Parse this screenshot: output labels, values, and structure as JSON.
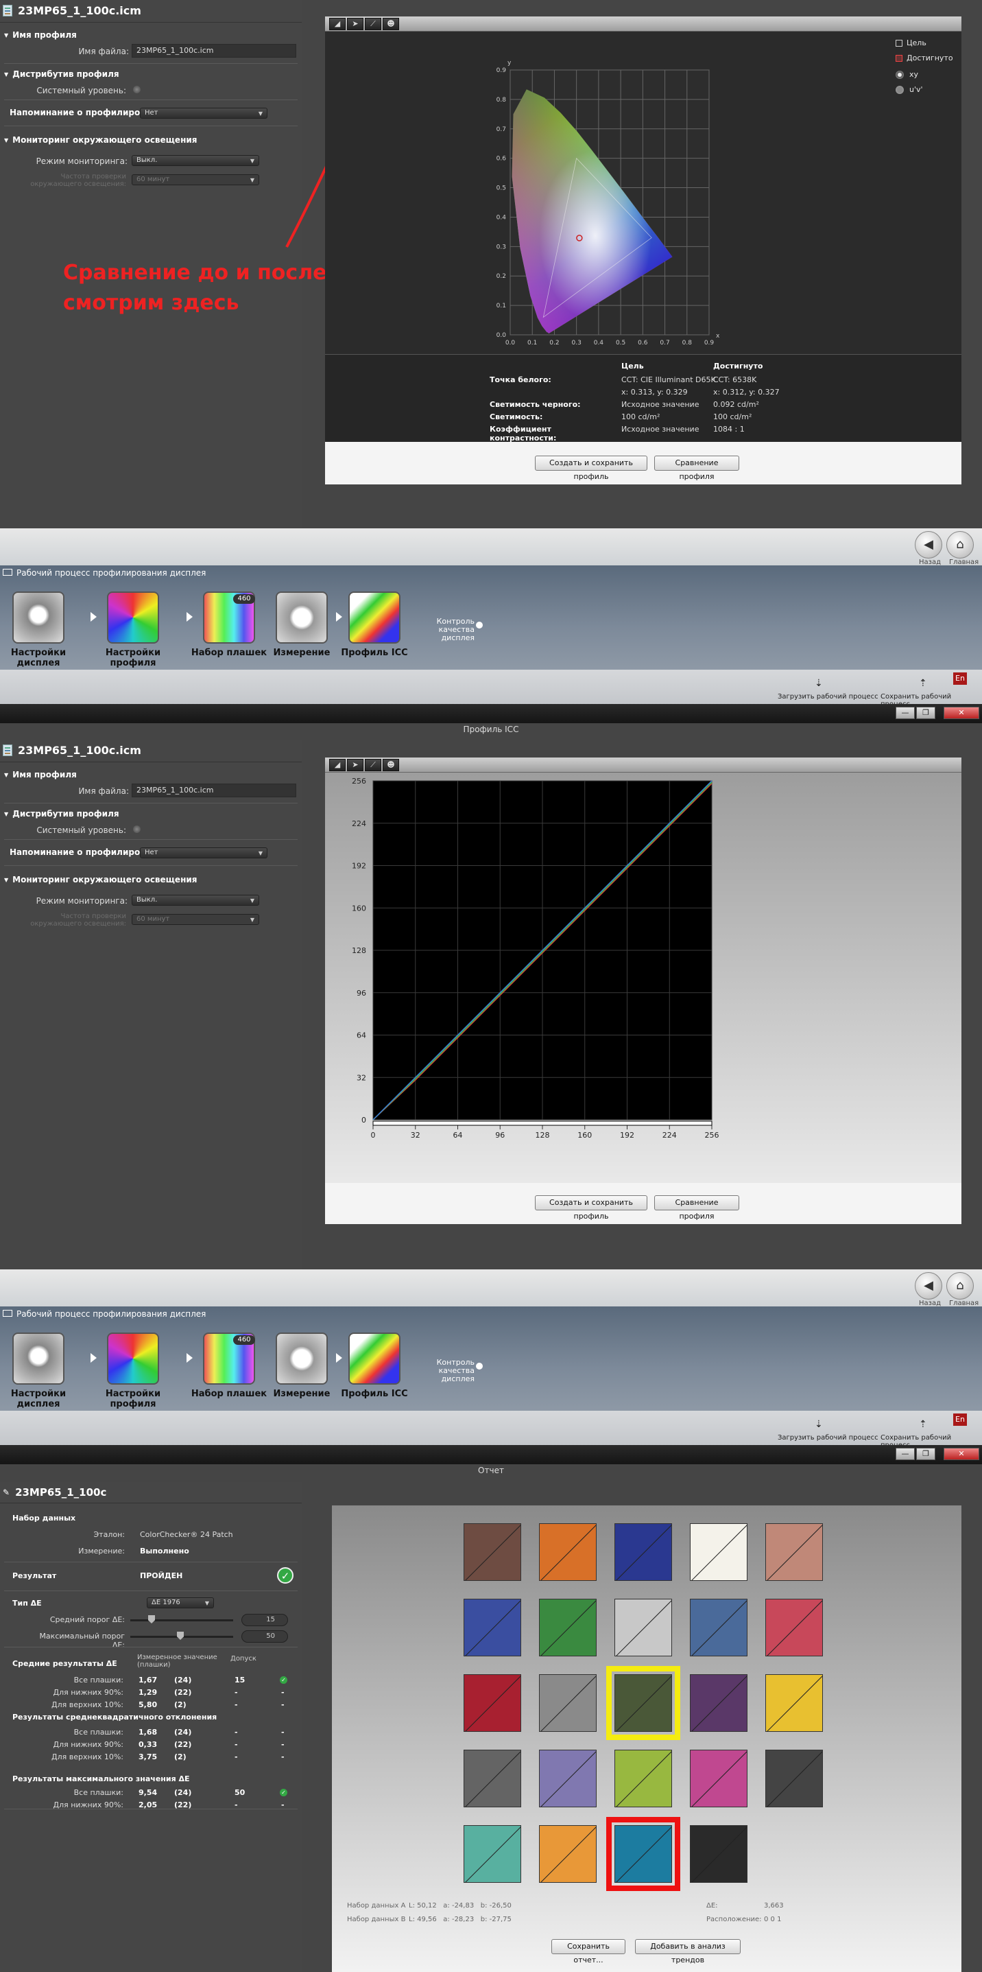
{
  "annotation": {
    "line1": "Сравнение до и после",
    "line2": "смотрим здесь",
    "color": "#ee2222"
  },
  "profile_panel": {
    "title": "23MP65_1_100c.icm",
    "sec_profile_name": "Имя профиля",
    "filename_label": "Имя файла:",
    "filename_value": "23MP65_1_100c.icm",
    "sec_distribution": "Дистрибутив профиля",
    "system_level_label": "Системный уровень:",
    "reminder_label": "Напоминание о профилировании",
    "reminder_value": "Нет",
    "sec_monitoring": "Мониторинг окружающего освещения",
    "monitoring_mode_label": "Режим мониторинга:",
    "monitoring_mode_value": "Выкл.",
    "frequency_label": "Частота проверки окружающего освещения:",
    "frequency_value": "60 минут"
  },
  "toolbar": {
    "tool1": "chromaticity-icon",
    "tool2": "cursor-icon",
    "tool3": "curve-icon",
    "tool4": "person-icon"
  },
  "gamut_chart": {
    "legend_target": "Цель",
    "legend_achieved": "Достигнуто",
    "radio_xy": "xy",
    "radio_uv": "u'v'",
    "col_target": "Цель",
    "col_achieved": "Достигнуто",
    "rows": [
      {
        "label": "Точка белого:",
        "target": "CCT: CIE Illuminant D65K",
        "achieved": "CCT: 6538K"
      },
      {
        "label": "",
        "target": "x: 0.313, y: 0.329",
        "achieved": "x: 0.312, y: 0.327"
      },
      {
        "label": "Светимость черного:",
        "target": "Исходное значение",
        "achieved": "0.092 cd/m²"
      },
      {
        "label": "Светимость:",
        "target": "100 cd/m²",
        "achieved": "100 cd/m²"
      },
      {
        "label": "Коэффициент контрастности:",
        "target": "Исходное значение",
        "achieved": "1084 : 1"
      }
    ]
  },
  "chart_data": [
    {
      "type": "scatter",
      "title": "",
      "xlabel": "x",
      "ylabel": "y",
      "xlim": [
        0,
        0.9
      ],
      "ylim": [
        0,
        0.9
      ],
      "xticks": [
        "0.0",
        "0.1",
        "0.2",
        "0.3",
        "0.4",
        "0.5",
        "0.6",
        "0.7",
        "0.8",
        "0.9"
      ],
      "yticks": [
        "0.0",
        "0.1",
        "0.2",
        "0.3",
        "0.4",
        "0.5",
        "0.6",
        "0.7",
        "0.8",
        "0.9"
      ],
      "grid": true,
      "white_point": {
        "x": 0.313,
        "y": 0.329
      },
      "gamut_triangle": [
        [
          0.64,
          0.33
        ],
        [
          0.3,
          0.6
        ],
        [
          0.15,
          0.06
        ]
      ]
    },
    {
      "type": "line",
      "title": "",
      "xlim": [
        0,
        256
      ],
      "ylim": [
        0,
        256
      ],
      "xticks": [
        "0",
        "32",
        "64",
        "96",
        "128",
        "160",
        "192",
        "224",
        "256"
      ],
      "yticks": [
        "0",
        "32",
        "64",
        "96",
        "128",
        "160",
        "192",
        "224",
        "256"
      ],
      "grid": true,
      "series": [
        {
          "color": "#d03a3a",
          "x": [
            0,
            32,
            64,
            96,
            128,
            160,
            192,
            224,
            256
          ],
          "y": [
            0,
            30,
            62,
            94,
            126,
            158,
            190,
            222,
            254
          ]
        },
        {
          "color": "#3ab83a",
          "x": [
            0,
            32,
            64,
            96,
            128,
            160,
            192,
            224,
            256
          ],
          "y": [
            0,
            31,
            63,
            95,
            127,
            159,
            191,
            223,
            255
          ]
        },
        {
          "color": "#3a7ad8",
          "x": [
            0,
            32,
            64,
            96,
            128,
            160,
            192,
            224,
            256
          ],
          "y": [
            0,
            32,
            64,
            96,
            128,
            160,
            192,
            224,
            256
          ]
        }
      ]
    }
  ],
  "buttons": {
    "create_save": "Создать и сохранить профиль",
    "compare": "Сравнение профиля",
    "save_report": "Сохранить отчет...",
    "add_trend": "Добавить в анализ трендов"
  },
  "workflow": {
    "title": "Рабочий процесс профилирования дисплея",
    "back": "Назад",
    "home": "Главная",
    "steps": [
      "Настройки дисплея",
      "Настройки профиля",
      "Набор плашек",
      "Измерение",
      "Профиль ICC"
    ],
    "patch_badge": "460",
    "qc": "Контроль качества дисплея",
    "load": "Загрузить рабочий процесс",
    "save": "Сохранить рабочий процесс",
    "lang": "En",
    "win_icc": "Профиль ICC",
    "win_report": "Отчет"
  },
  "report": {
    "title": "23MP65_1_100c",
    "dataset": "Набор данных",
    "ref_label": "Эталон:",
    "ref_value": "ColorChecker® 24 Patch",
    "meas_label": "Измерение:",
    "meas_value": "Выполнено",
    "result_label": "Результат",
    "result_value": "ПРОЙДЕН",
    "de_type_label": "Тип ΔE",
    "de_type_value": "ΔE 1976",
    "avg_thresh_label": "Средний порог ΔE:",
    "avg_thresh": "15",
    "max_thresh_label": "Максимальный порог ΔE:",
    "max_thresh": "50",
    "avg_sec": "Средние результаты ΔE",
    "col_measured": "Измеренное значение (плашки)",
    "col_tolerance": "Допуск",
    "avg_rows": [
      {
        "label": "Все плашки:",
        "v": "1,67",
        "n": "(24)",
        "tol": "15",
        "pass": true
      },
      {
        "label": "Для нижних 90%:",
        "v": "1,29",
        "n": "(22)",
        "tol": "-",
        "pass": false
      },
      {
        "label": "Для верхних 10%:",
        "v": "5,80",
        "n": "(2)",
        "tol": "-",
        "pass": false
      }
    ],
    "std_sec": "Результаты среднеквадратичного отклонения",
    "std_rows": [
      {
        "label": "Все плашки:",
        "v": "1,68",
        "n": "(24)",
        "tol": "-"
      },
      {
        "label": "Для нижних 90%:",
        "v": "0,33",
        "n": "(22)",
        "tol": "-"
      },
      {
        "label": "Для верхних 10%:",
        "v": "3,75",
        "n": "(2)",
        "tol": "-"
      }
    ],
    "max_sec": "Результаты максимального значения ΔE",
    "max_rows": [
      {
        "label": "Все плашки:",
        "v": "9,54",
        "n": "(24)",
        "tol": "50",
        "pass": true
      },
      {
        "label": "Для нижних 90%:",
        "v": "2,05",
        "n": "(22)",
        "tol": "-",
        "pass": false
      }
    ],
    "patches": [
      "#6e4c42",
      "#d87028",
      "#2a3890",
      "#f4f2ea",
      "#c08878",
      "#3a4ea0",
      "#3a8a40",
      "#c8c8c8",
      "#4a6a9a",
      "#c8485a",
      "#a82030",
      "#8a8a8a",
      "#4a5838",
      "#5a3868",
      "#e8c030",
      "#646464",
      "#8078b0",
      "#98b840",
      "#c04890",
      "#444444",
      "#58b0a0",
      "#e89838",
      "#1c7ca0",
      "#2a2a2a"
    ],
    "dataset_a_label": "Набор данных A",
    "dataset_a": "L: 50,12   a: -24,83   b: -26,50",
    "dataset_b_label": "Набор данных B",
    "dataset_b": "L: 49,56   a: -28,23   b: -27,75",
    "de_label": "ΔE:",
    "de_value": "3,663",
    "loc_label": "Расположение:",
    "loc_value": "0 0 1"
  }
}
